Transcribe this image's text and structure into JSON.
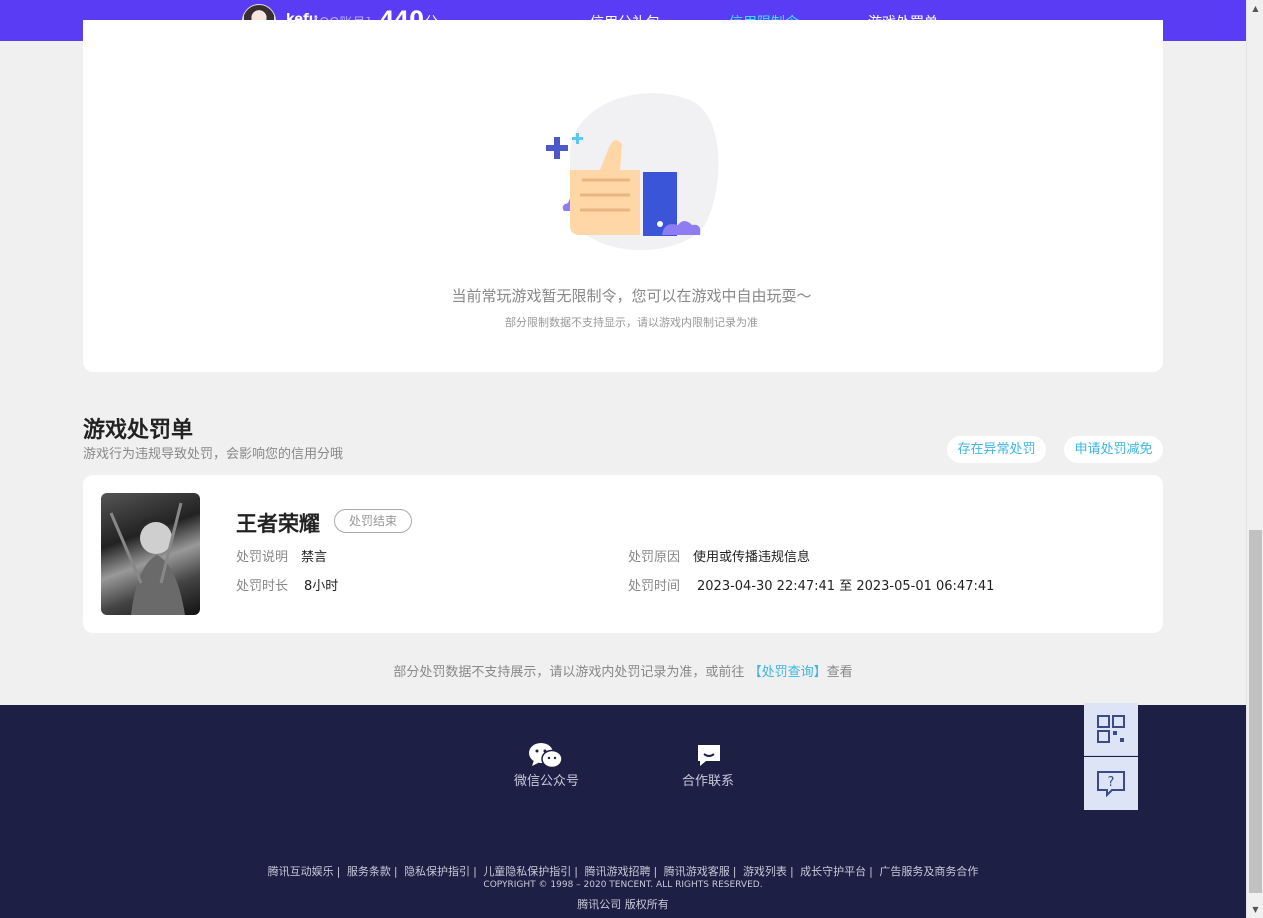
{
  "header": {
    "username": "kefu",
    "account_type": "[QQ账号]",
    "score": "440",
    "score_unit": "分",
    "tabs": [
      {
        "label": "信用分礼包"
      },
      {
        "label": "信用限制令"
      },
      {
        "label": "游戏处罚单"
      }
    ]
  },
  "restriction": {
    "empty_message": "当前常玩游戏暂无限制令，您可以在游戏中自由玩耍～",
    "empty_note": "部分限制数据不支持显示，请以游戏内限制记录为准"
  },
  "penalty_section": {
    "title": "游戏处罚单",
    "subtitle": "游戏行为违规导致处罚，会影响您的信用分哦",
    "abnormal_button": "存在异常处罚",
    "appeal_button": "申请处罚减免"
  },
  "penalty_record": {
    "game_name": "王者荣耀",
    "status": "处罚结束",
    "desc_label": "处罚说明",
    "desc_value": "禁言",
    "reason_label": "处罚原因",
    "reason_value": "使用或传播违规信息",
    "duration_label": "处罚时长",
    "duration_value": "8小时",
    "time_label": "处罚时间",
    "time_value": "2023-04-30 22:47:41 至 2023-05-01 06:47:41"
  },
  "note": {
    "prefix": "部分处罚数据不支持展示，请以游戏内处罚记录为准，或前往",
    "link": "【处罚查询】",
    "suffix": "查看"
  },
  "footer": {
    "wechat_label": "微信公众号",
    "cooperation_label": "合作联系",
    "links": [
      "腾讯互动娱乐",
      "服务条款",
      "隐私保护指引",
      "儿童隐私保护指引",
      "腾讯游戏招聘",
      "腾讯游戏客服",
      "游戏列表",
      "成长守护平台",
      "广告服务及商务合作"
    ],
    "copyright": "COPYRIGHT © 1998 – 2020 TENCENT. ALL RIGHTS RESERVED.",
    "rights": "腾讯公司 版权所有"
  },
  "side_tools": {
    "icons": [
      "qrcode-icon",
      "feedback-icon"
    ]
  },
  "colors": {
    "brand": "#5a3cf5",
    "accent": "#3ee0f4",
    "link": "#3bb6e6",
    "footer_bg": "#1d1f45"
  }
}
